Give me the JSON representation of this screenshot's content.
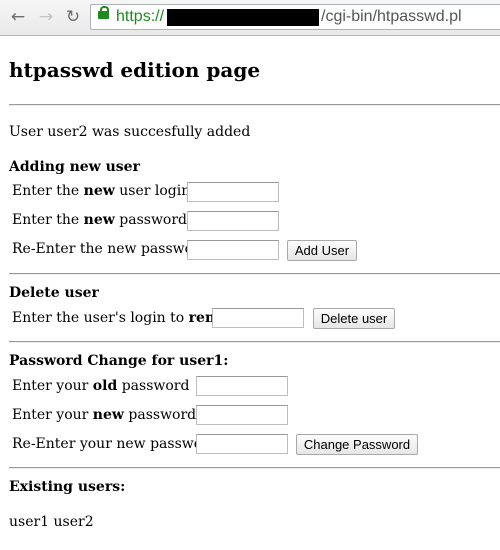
{
  "browser": {
    "url_scheme": "https://",
    "url_path": "/cgi-bin/htpasswd.pl"
  },
  "page": {
    "title": "htpasswd edition page",
    "status_message": "User user2 was succesfully added"
  },
  "add_user": {
    "heading": "Adding new user",
    "login_label_pre": "Enter the ",
    "login_label_bold": "new",
    "login_label_post": " user login",
    "password_label_pre": "Enter the ",
    "password_label_bold": "new",
    "password_label_post": " password",
    "reenter_label": "Re-Enter the new password",
    "button_label": "Add User"
  },
  "delete_user": {
    "heading": "Delete user",
    "label_pre": "Enter the user's login to ",
    "label_bold": "remove",
    "button_label": "Delete user"
  },
  "password_change": {
    "heading": "Password Change for user1:",
    "old_label_pre": "Enter your ",
    "old_label_bold": "old",
    "old_label_post": " password",
    "new_label_pre": "Enter your ",
    "new_label_bold": "new",
    "new_label_post": " password",
    "reenter_label": "Re-Enter your new password",
    "button_label": "Change Password"
  },
  "existing_users": {
    "heading": "Existing users:",
    "list": "user1 user2"
  }
}
